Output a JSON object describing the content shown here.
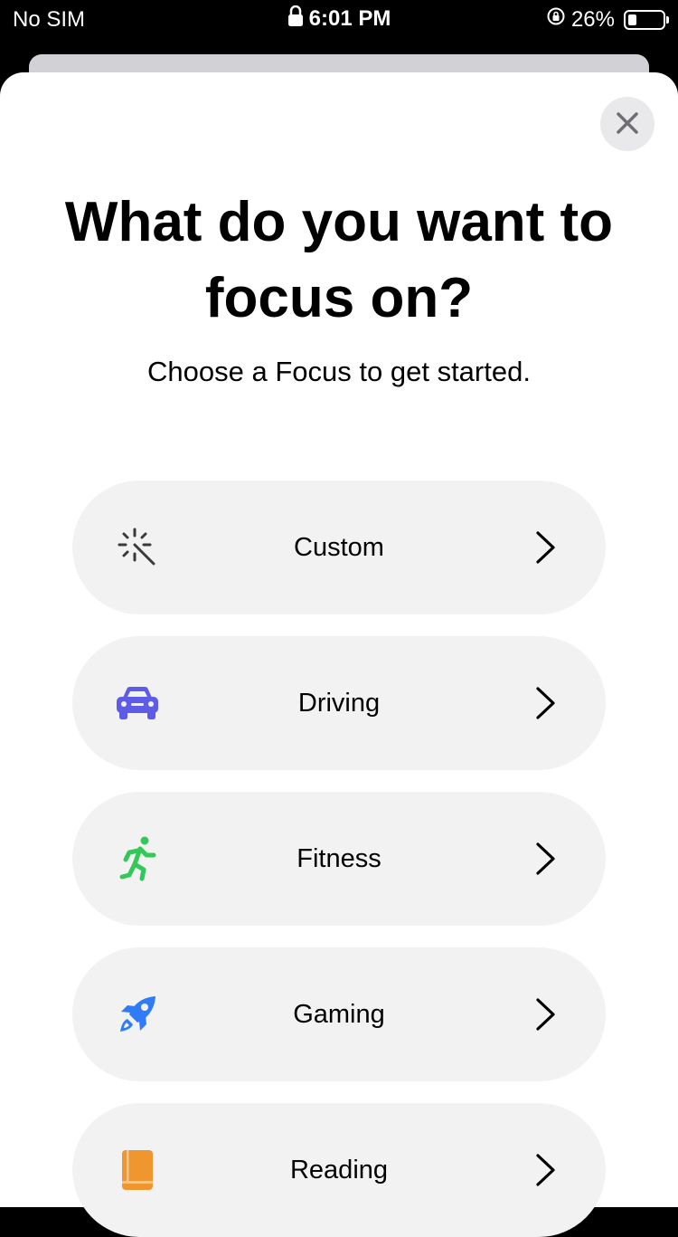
{
  "status_bar": {
    "carrier": "No SIM",
    "time": "6:01 PM",
    "battery": "26%",
    "battery_level": 0.26
  },
  "sheet": {
    "title": "What do you want to focus on?",
    "subtitle": "Choose a Focus to get started.",
    "close_icon": "close-icon",
    "options": [
      {
        "label": "Custom",
        "icon": "magic-wand-icon",
        "color": "#3a3a3c"
      },
      {
        "label": "Driving",
        "icon": "car-icon",
        "color": "#5e5ce6"
      },
      {
        "label": "Fitness",
        "icon": "running-figure-icon",
        "color": "#34c759"
      },
      {
        "label": "Gaming",
        "icon": "rocket-icon",
        "color": "#2f7cf6"
      },
      {
        "label": "Reading",
        "icon": "book-icon",
        "color": "#f0962e"
      }
    ]
  }
}
